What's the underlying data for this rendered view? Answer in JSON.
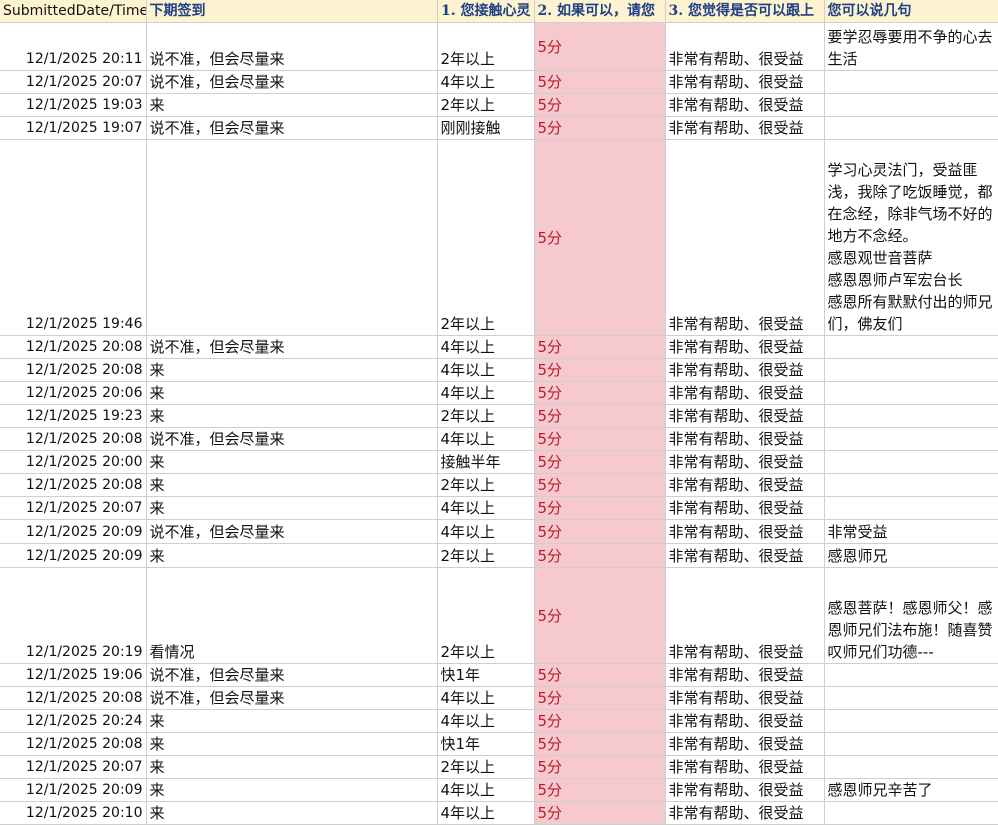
{
  "headers": {
    "date": "SubmittedDate/Time",
    "signin": "下期签到",
    "q1": "1. 您接触心灵",
    "q2": "2. 如果可以，请您",
    "q3": "3. 您觉得是否可以跟上",
    "q4": "您可以说几句"
  },
  "rows": [
    {
      "date": "12/1/2025 20:11",
      "signin": "说不准，但会尽量来",
      "q1": "2年以上",
      "q2": "5分",
      "q3": "非常有帮助、很受益",
      "q4": "要学忍辱要用不争的心去生活"
    },
    {
      "date": "12/1/2025 20:07",
      "signin": "说不准，但会尽量来",
      "q1": "4年以上",
      "q2": "5分",
      "q3": "非常有帮助、很受益",
      "q4": ""
    },
    {
      "date": "12/1/2025 19:03",
      "signin": "来",
      "q1": "2年以上",
      "q2": "5分",
      "q3": "非常有帮助、很受益",
      "q4": ""
    },
    {
      "date": "12/1/2025 19:07",
      "signin": "说不准，但会尽量来",
      "q1": "刚刚接触",
      "q2": "5分",
      "q3": "非常有帮助、很受益",
      "q4": ""
    },
    {
      "date": "12/1/2025 19:46",
      "signin": "",
      "q1": "2年以上",
      "q2": "5分",
      "q3": "非常有帮助、很受益",
      "q4": "学习心灵法门，受益匪浅，我除了吃饭睡觉，都在念经，除非气场不好的地方不念经。\n感恩观世音菩萨\n感恩恩师卢军宏台长\n感恩所有默默付出的师兄们，佛友们"
    },
    {
      "date": "12/1/2025 20:08",
      "signin": "说不准，但会尽量来",
      "q1": "4年以上",
      "q2": "5分",
      "q3": "非常有帮助、很受益",
      "q4": ""
    },
    {
      "date": "12/1/2025 20:08",
      "signin": "来",
      "q1": "4年以上",
      "q2": "5分",
      "q3": "非常有帮助、很受益",
      "q4": ""
    },
    {
      "date": "12/1/2025 20:06",
      "signin": "来",
      "q1": "4年以上",
      "q2": "5分",
      "q3": "非常有帮助、很受益",
      "q4": ""
    },
    {
      "date": "12/1/2025 19:23",
      "signin": "来",
      "q1": "2年以上",
      "q2": "5分",
      "q3": "非常有帮助、很受益",
      "q4": ""
    },
    {
      "date": "12/1/2025 20:08",
      "signin": "说不准，但会尽量来",
      "q1": "4年以上",
      "q2": "5分",
      "q3": "非常有帮助、很受益",
      "q4": ""
    },
    {
      "date": "12/1/2025 20:00",
      "signin": "来",
      "q1": "接触半年",
      "q2": "5分",
      "q3": "非常有帮助、很受益",
      "q4": ""
    },
    {
      "date": "12/1/2025 20:08",
      "signin": "来",
      "q1": "2年以上",
      "q2": "5分",
      "q3": "非常有帮助、很受益",
      "q4": ""
    },
    {
      "date": "12/1/2025 20:07",
      "signin": "来",
      "q1": "4年以上",
      "q2": "5分",
      "q3": "非常有帮助、很受益",
      "q4": ""
    },
    {
      "date": "12/1/2025 20:09",
      "signin": "说不准，但会尽量来",
      "q1": "4年以上",
      "q2": "5分",
      "q3": "非常有帮助、很受益",
      "q4": "非常受益"
    },
    {
      "date": "12/1/2025 20:09",
      "signin": "来",
      "q1": "2年以上",
      "q2": "5分",
      "q3": "非常有帮助、很受益",
      "q4": "感恩师兄"
    },
    {
      "date": "12/1/2025 20:19",
      "signin": "看情况",
      "q1": "2年以上",
      "q2": "5分",
      "q3": "非常有帮助、很受益",
      "q4": "感恩菩萨！感恩师父！感恩师兄们法布施！随喜赞叹师兄们功德---"
    },
    {
      "date": "12/1/2025 19:06",
      "signin": "说不准，但会尽量来",
      "q1": "快1年",
      "q2": "5分",
      "q3": "非常有帮助、很受益",
      "q4": ""
    },
    {
      "date": "12/1/2025 20:08",
      "signin": "说不准，但会尽量来",
      "q1": "4年以上",
      "q2": "5分",
      "q3": "非常有帮助、很受益",
      "q4": ""
    },
    {
      "date": "12/1/2025 20:24",
      "signin": "来",
      "q1": "4年以上",
      "q2": "5分",
      "q3": "非常有帮助、很受益",
      "q4": ""
    },
    {
      "date": "12/1/2025 20:08",
      "signin": "来",
      "q1": "快1年",
      "q2": "5分",
      "q3": "非常有帮助、很受益",
      "q4": ""
    },
    {
      "date": "12/1/2025 20:07",
      "signin": "来",
      "q1": "2年以上",
      "q2": "5分",
      "q3": "非常有帮助、很受益",
      "q4": ""
    },
    {
      "date": "12/1/2025 20:09",
      "signin": "来",
      "q1": "4年以上",
      "q2": "5分",
      "q3": "非常有帮助、很受益",
      "q4": "感恩师兄辛苦了"
    },
    {
      "date": "12/1/2025 20:10",
      "signin": "来",
      "q1": "4年以上",
      "q2": "5分",
      "q3": "非常有帮助、很受益",
      "q4": ""
    }
  ],
  "colors": {
    "header_bg": "#fdf3d0",
    "header_text": "#1f3f86",
    "score_bg": "#f6c9cf",
    "score_text": "#b81d2a"
  }
}
